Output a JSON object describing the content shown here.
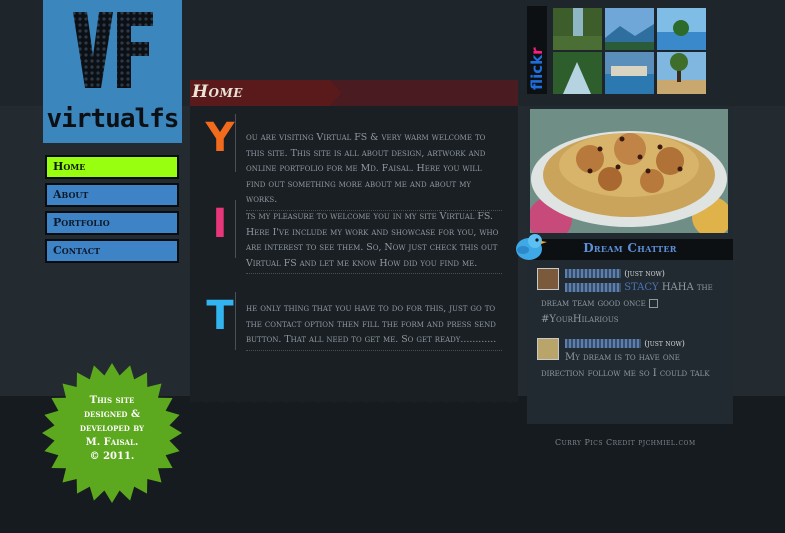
{
  "colors": {
    "background": "#1b2127",
    "logo_bg": "#3a86bd",
    "nav_blue": "#3f83c7",
    "nav_active": "#99ff11",
    "header_red": "#6b1e20",
    "letter_y": "#f26b1d",
    "letter_i": "#e8367a",
    "letter_t": "#31b4f0",
    "star_green": "#5ca81e",
    "chatter_title": "#5d8fd8"
  },
  "logo": {
    "monogram": "VF",
    "name": "virtualfs"
  },
  "nav": {
    "items": [
      "Home",
      "About",
      "Portfolio",
      "Contact"
    ],
    "active": "Home"
  },
  "home": {
    "title": "Home"
  },
  "sections": [
    {
      "letter": "Y",
      "text": "ou are visiting Virtual FS & very warm welcome to this site. This site is all about design, artwork and online portfolio for me Md. Faisal. Here you will find out something more about me and about my works."
    },
    {
      "letter": "I",
      "text": "ts my pleasure to welcome you in my site Virtual FS. Here I've include my work and showcase for you, who are interest to see them. So, Now just check this out Virtual FS and let me know How did you find me."
    },
    {
      "letter": "T",
      "text": "he only thing that you have to do for this, just go to the contact option then fill the form and press send button. That all need to get me. So get ready............"
    }
  ],
  "flickr": {
    "label": "flickr"
  },
  "chatter": {
    "title": "Dream Chatter",
    "tweets": [
      {
        "time": "(just now)",
        "mention": "STACY",
        "body_line1": "HAHA the",
        "body_line2": "dream team good once",
        "body_line3": "#YourHilarious"
      },
      {
        "time": "(just now)",
        "body_line1": "My dream is to have one",
        "body_line2": "direction follow me so I could talk"
      }
    ]
  },
  "credit": "Curry Pics Credit  pjchmiel.com",
  "badge": {
    "line1": "This site",
    "line2": "designed &",
    "line3": "developed by",
    "line4": "M. Faisal.",
    "line5": "© 2011."
  }
}
